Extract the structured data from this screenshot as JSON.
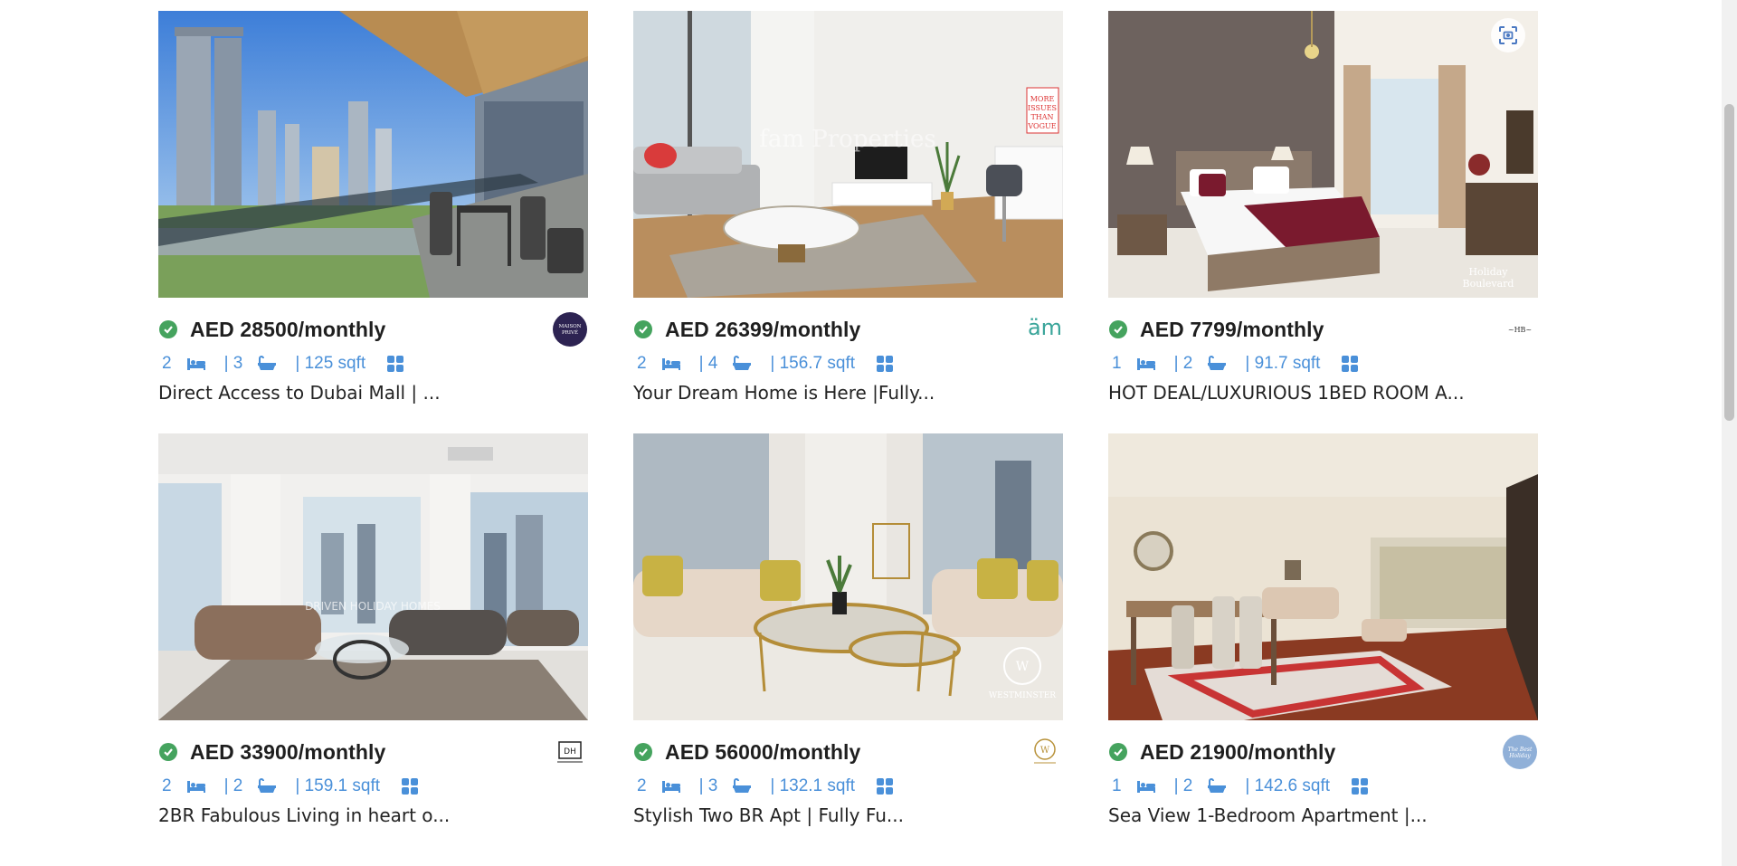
{
  "listings": [
    {
      "price": "AED 28500/monthly",
      "beds": "2",
      "baths": "| 3",
      "area": "| 125 sqft",
      "title": "Direct Access to Dubai Mall | ...",
      "agency_logo": "MAISON PRIVÉ"
    },
    {
      "price": "AED 26399/monthly",
      "beds": "2",
      "baths": "| 4",
      "area": "| 156.7 sqft",
      "title": "Your Dream Home is Here |Fully...",
      "agency_logo": "äm",
      "photo_watermark": "fam Properties"
    },
    {
      "price": "AED 7799/monthly",
      "beds": "1",
      "baths": "| 2",
      "area": "| 91.7 sqft",
      "title": "HOT DEAL/LUXURIOUS 1BED ROOM A...",
      "agency_logo": "Holiday Boulevard",
      "photo_watermark": "Holiday Boulevard"
    },
    {
      "price": "AED 33900/monthly",
      "beds": "2",
      "baths": "| 2",
      "area": "| 159.1 sqft",
      "title": "2BR Fabulous Living in heart o...",
      "agency_logo": "DH",
      "photo_watermark": "DRIVEN HOLIDAY HOMES"
    },
    {
      "price": "AED 56000/monthly",
      "beds": "2",
      "baths": "| 3",
      "area": "| 132.1 sqft",
      "title": "Stylish Two BR Apt | Fully Fu...",
      "agency_logo": "Westminster",
      "photo_watermark": "WESTMINSTER"
    },
    {
      "price": "AED 21900/monthly",
      "beds": "1",
      "baths": "| 2",
      "area": "| 142.6 sqft",
      "title": "Sea View 1-Bedroom Apartment |...",
      "agency_logo": "Holiday"
    }
  ],
  "colors": {
    "verified": "#45a35e",
    "spec_blue": "#4a90d9",
    "price_text": "#1f1f1f"
  },
  "icons": {
    "verified": "check-circle-icon",
    "bed": "bed-icon",
    "bath": "bathtub-icon",
    "area": "grid-icon",
    "scan": "scan-icon"
  }
}
